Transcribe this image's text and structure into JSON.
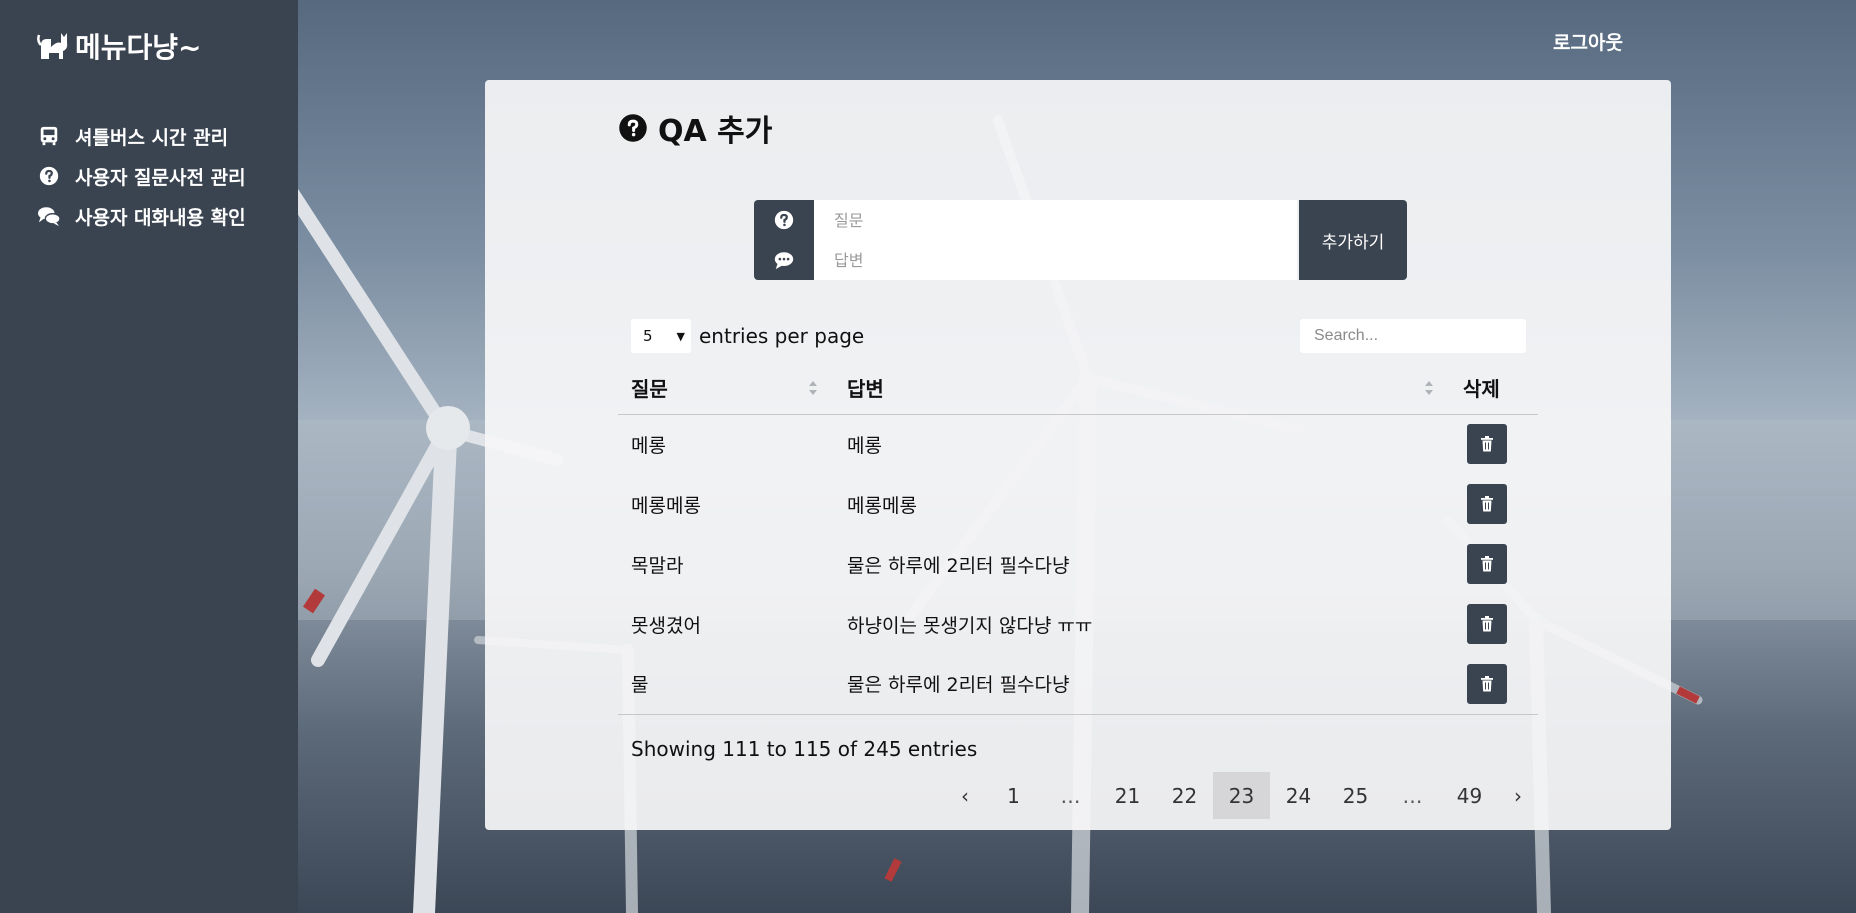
{
  "sidebar": {
    "brand": "메뉴다냥~",
    "items": [
      {
        "label": "셔틀버스 시간 관리",
        "icon": "bus-icon"
      },
      {
        "label": "사용자 질문사전 관리",
        "icon": "question-circle-icon"
      },
      {
        "label": "사용자 대화내용 확인",
        "icon": "comments-icon"
      }
    ]
  },
  "header": {
    "logout": "로그아웃"
  },
  "main": {
    "title": "QA 추가",
    "form": {
      "question_placeholder": "질문",
      "answer_placeholder": "답변",
      "add_label": "추가하기"
    },
    "table_controls": {
      "per_page_value": "5",
      "per_page_label": "entries per page",
      "search_placeholder": "Search..."
    },
    "table": {
      "headers": [
        "질문",
        "답변",
        "삭제"
      ],
      "rows": [
        {
          "question": "메롱",
          "answer": "메롱"
        },
        {
          "question": "메롱메롱",
          "answer": "메롱메롱"
        },
        {
          "question": "목말라",
          "answer": "물은 하루에 2리터 필수다냥"
        },
        {
          "question": "못생겼어",
          "answer": "하냥이는 못생기지 않다냥 ㅠㅠ"
        },
        {
          "question": "물",
          "answer": "물은 하루에 2리터 필수다냥"
        }
      ]
    },
    "showing": "Showing 111 to 115 of 245 entries",
    "pagination": {
      "prev": "‹",
      "pages": [
        "1",
        "…",
        "21",
        "22",
        "23",
        "24",
        "25",
        "…",
        "49"
      ],
      "current": "23",
      "next": "›"
    }
  },
  "colors": {
    "sidebar_bg": "#3a4350",
    "button_bg": "#3a4350",
    "card_bg": "#f6f6f8",
    "active_page_bg": "#d6d6d9"
  }
}
